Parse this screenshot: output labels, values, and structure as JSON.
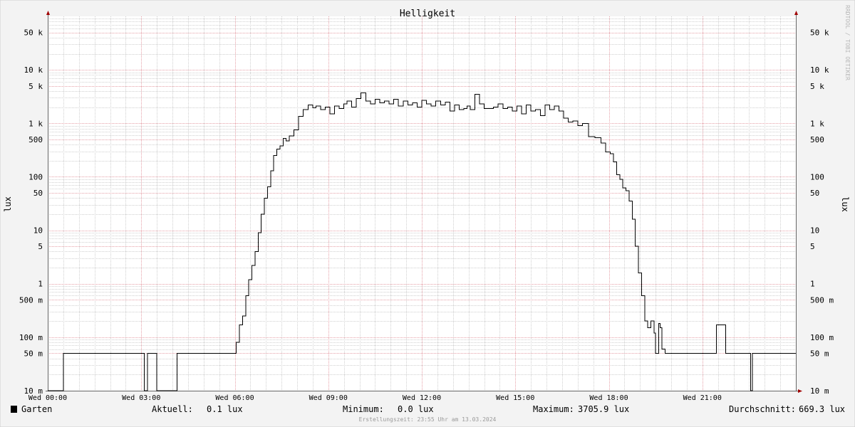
{
  "chart_data": {
    "type": "line",
    "title": "Helligkeit",
    "ylabel": "lux",
    "ylabel_right": "lux",
    "watermark": "RRDTOOL / TOBI OETIKER",
    "y_scale": "log",
    "ylim": [
      0.01,
      100000
    ],
    "x_ticks": [
      {
        "label": "Wed 00:00",
        "hour": 0
      },
      {
        "label": "Wed 03:00",
        "hour": 3
      },
      {
        "label": "Wed 06:00",
        "hour": 6
      },
      {
        "label": "Wed 09:00",
        "hour": 9
      },
      {
        "label": "Wed 12:00",
        "hour": 12
      },
      {
        "label": "Wed 15:00",
        "hour": 15
      },
      {
        "label": "Wed 18:00",
        "hour": 18
      },
      {
        "label": "Wed 21:00",
        "hour": 21
      }
    ],
    "y_ticks": [
      {
        "label": "10 m",
        "value": 0.01
      },
      {
        "label": "50 m",
        "value": 0.05
      },
      {
        "label": "100 m",
        "value": 0.1
      },
      {
        "label": "500 m",
        "value": 0.5
      },
      {
        "label": "1",
        "value": 1
      },
      {
        "label": "5",
        "value": 5
      },
      {
        "label": "10",
        "value": 10
      },
      {
        "label": "50",
        "value": 50
      },
      {
        "label": "100",
        "value": 100
      },
      {
        "label": "500",
        "value": 500
      },
      {
        "label": "1 k",
        "value": 1000
      },
      {
        "label": "5 k",
        "value": 5000
      },
      {
        "label": "10 k",
        "value": 10000
      },
      {
        "label": "50 k",
        "value": 50000
      }
    ],
    "series": [
      {
        "name": "Garten",
        "color": "#000000",
        "x_hours": [
          0.0,
          0.45,
          0.5,
          0.6,
          0.65,
          3.05,
          3.1,
          3.2,
          3.25,
          3.45,
          3.5,
          4.1,
          4.15,
          6.0,
          6.05,
          6.15,
          6.25,
          6.35,
          6.45,
          6.55,
          6.65,
          6.75,
          6.85,
          6.95,
          7.05,
          7.15,
          7.25,
          7.35,
          7.45,
          7.55,
          7.65,
          7.75,
          7.9,
          8.05,
          8.2,
          8.35,
          8.5,
          8.6,
          8.75,
          8.9,
          9.05,
          9.2,
          9.35,
          9.5,
          9.6,
          9.75,
          9.9,
          10.05,
          10.2,
          10.35,
          10.5,
          10.65,
          10.8,
          10.95,
          11.1,
          11.25,
          11.4,
          11.55,
          11.7,
          11.85,
          12.0,
          12.15,
          12.3,
          12.45,
          12.6,
          12.75,
          12.9,
          13.05,
          13.2,
          13.35,
          13.45,
          13.55,
          13.7,
          13.85,
          14.0,
          14.15,
          14.3,
          14.45,
          14.6,
          14.75,
          14.9,
          15.05,
          15.2,
          15.35,
          15.5,
          15.65,
          15.8,
          15.95,
          16.1,
          16.25,
          16.4,
          16.55,
          16.7,
          16.85,
          17.0,
          17.15,
          17.35,
          17.55,
          17.75,
          17.9,
          18.05,
          18.15,
          18.25,
          18.35,
          18.45,
          18.55,
          18.65,
          18.75,
          18.85,
          18.95,
          19.05,
          19.15,
          19.25,
          19.35,
          19.45,
          19.5,
          19.55,
          19.6,
          19.65,
          19.7,
          19.8,
          19.9,
          20.0,
          20.3,
          20.6,
          21.0,
          21.4,
          21.45,
          21.7,
          21.75,
          21.85,
          22.2,
          22.5,
          22.55,
          22.6,
          22.65,
          22.8,
          24.0
        ],
        "y_lux": [
          0.01,
          0.01,
          0.05,
          0.05,
          0.05,
          0.05,
          0.01,
          0.05,
          0.05,
          0.05,
          0.01,
          0.01,
          0.05,
          0.05,
          0.08,
          0.17,
          0.25,
          0.6,
          1.2,
          2.2,
          4,
          9,
          20,
          40,
          65,
          130,
          250,
          330,
          380,
          520,
          470,
          580,
          750,
          1350,
          1800,
          2200,
          1950,
          2100,
          1800,
          2000,
          1500,
          2100,
          1900,
          2300,
          2600,
          2000,
          2900,
          3700,
          2600,
          2300,
          2800,
          2400,
          2600,
          2300,
          2800,
          2100,
          2600,
          2200,
          2400,
          2000,
          2700,
          2300,
          2100,
          2600,
          2200,
          2500,
          1700,
          2200,
          1800,
          1900,
          2100,
          1800,
          3500,
          2300,
          1900,
          1900,
          2000,
          2300,
          1900,
          2000,
          1700,
          2100,
          1500,
          2200,
          1700,
          1800,
          1400,
          2200,
          1800,
          2100,
          1700,
          1250,
          1050,
          1100,
          900,
          1000,
          560,
          540,
          430,
          290,
          270,
          190,
          110,
          90,
          62,
          55,
          35,
          16,
          5,
          1.6,
          0.6,
          0.2,
          0.15,
          0.2,
          0.12,
          0.05,
          0.05,
          0.18,
          0.15,
          0.06,
          0.05,
          0.05,
          0.05,
          0.05,
          0.05,
          0.05,
          0.05,
          0.17,
          0.17,
          0.05,
          0.05,
          0.05,
          0.05,
          0.01,
          0.05,
          0.05,
          0.05,
          0.05
        ]
      }
    ],
    "legend": [
      {
        "label": "Garten",
        "color": "#000000"
      }
    ],
    "stats": [
      {
        "label": "Aktuell:",
        "value": "0.1 lux"
      },
      {
        "label": "Minimum:",
        "value": "0.0 lux"
      },
      {
        "label": "Maximum:",
        "value": "3705.9 lux"
      },
      {
        "label": "Durchschnitt:",
        "value": "669.3 lux"
      }
    ],
    "footer": "Erstellungszeit: 23:55 Uhr am 13.03.2024",
    "colors": {
      "background": "#f3f3f3",
      "plot_background": "#ffffff",
      "major_grid": "#e6a0a8",
      "minor_grid": "#d0d0d0",
      "axis": "#666666",
      "arrow": "#a00000"
    }
  }
}
